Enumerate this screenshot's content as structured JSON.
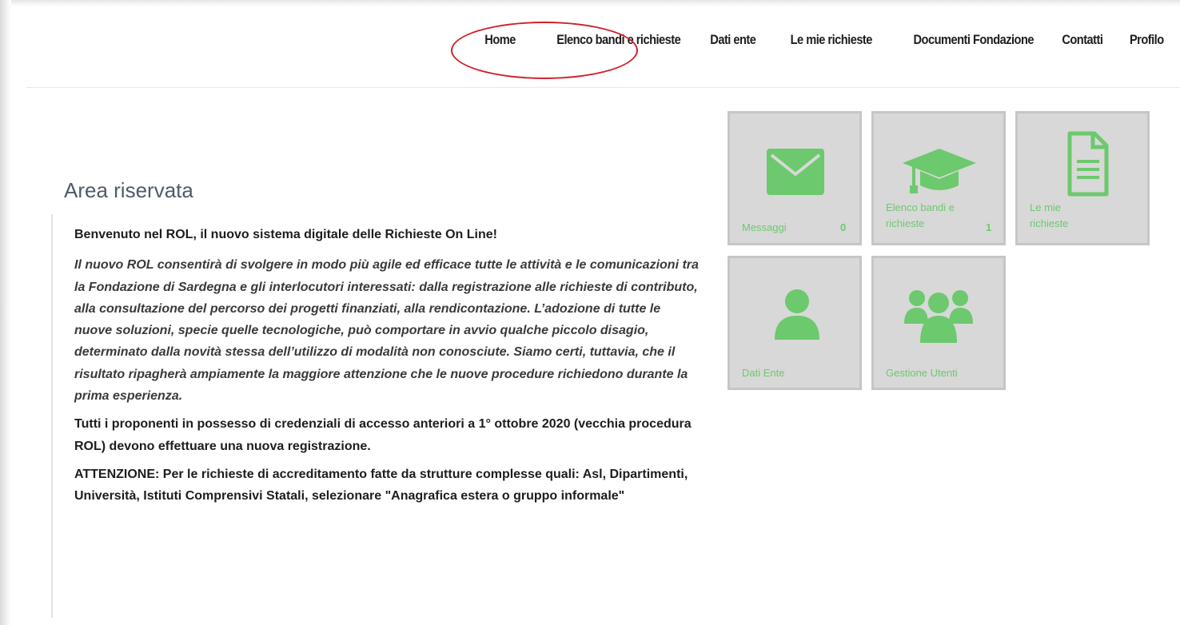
{
  "nav": {
    "items": [
      {
        "label": "Home"
      },
      {
        "label": "Elenco bandi e richieste"
      },
      {
        "label": "Dati ente"
      },
      {
        "label": "Le mie richieste"
      },
      {
        "label": "Documenti Fondazione"
      },
      {
        "label": "Contatti"
      },
      {
        "label": "Profilo"
      }
    ]
  },
  "main": {
    "title": "Area riservata",
    "welcome": "Benvenuto nel ROL, il nuovo sistema digitale delle Richieste On Line!",
    "intro": "Il nuovo ROL consentirà di svolgere in modo più agile ed efficace tutte le attività e le comunicazioni tra la Fondazione di Sardegna e gli interlocutori interessati: dalla registrazione alle richieste di contributo, alla consultazione del percorso dei progetti finanziati, alla rendicontazione. L’adozione di tutte le nuove soluzioni, specie quelle tecnologiche, può comportare in avvio qualche piccolo disagio, determinato dalla novità stessa dell’utilizzo di modalità non conosciute. Siamo certi, tuttavia, che il risultato ripagherà ampiamente la maggiore attenzione che le nuove procedure richiedono durante la prima esperienza.",
    "registration_note": "Tutti i proponenti in possesso di credenziali di accesso anteriori a 1° ottobre 2020 (vecchia procedura ROL) devono effettuare una nuova registrazione.",
    "attention_note": "ATTENZIONE: Per le richieste di accreditamento fatte da  strutture complesse quali: Asl, Dipartimenti, Università, Istituti Comprensivi Statali,  selezionare  \"Anagrafica estera o gruppo informale\""
  },
  "tiles": [
    {
      "label": "Messaggi",
      "count": "0",
      "icon": "envelope-icon"
    },
    {
      "label": "Elenco bandi e richieste",
      "count": "1",
      "icon": "graduation-cap-icon"
    },
    {
      "label": "Le mie richieste",
      "icon": "document-icon"
    },
    {
      "label": "Dati Ente",
      "icon": "user-icon"
    },
    {
      "label": "Gestione Utenti",
      "icon": "users-group-icon"
    }
  ],
  "colors": {
    "accent": "#6cc96d",
    "tile_bg": "#d8d8d8",
    "annotation": "#d0202a"
  }
}
